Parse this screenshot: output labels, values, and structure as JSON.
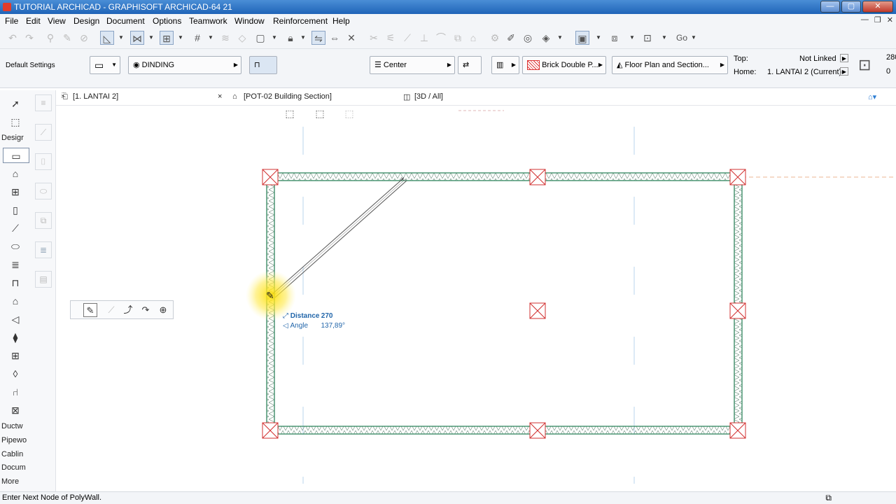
{
  "window": {
    "title": "TUTORIAL ARCHICAD - GRAPHISOFT ARCHICAD-64 21",
    "min": "—",
    "max": "▢",
    "close": "✕"
  },
  "menu": [
    "File",
    "Edit",
    "View",
    "Design",
    "Document",
    "Options",
    "Teamwork",
    "Window",
    "Reinforcement",
    "Help"
  ],
  "toolbar": {
    "go_label": "Go"
  },
  "infobox": {
    "default_settings": "Default Settings",
    "layer": "DINDING",
    "reference_line": "Center",
    "material": "Brick Double P...",
    "view_scope": "Floor Plan and Section...",
    "top_label": "Top:",
    "top_value": "Not Linked",
    "home_label": "Home:",
    "home_value": "1. LANTAI 2 (Current)",
    "height_value": "280",
    "offset_value": "0"
  },
  "tabs": [
    {
      "label": "[1. LANTAI 2]",
      "close": "×"
    },
    {
      "label": "[POT-02 Building Section]"
    },
    {
      "label": "[3D / All]"
    }
  ],
  "toolbox": {
    "design_label": "Desigr",
    "ductwork_label": "Ductw",
    "pipework_label": "Pipewo",
    "cabling_label": "Cablin",
    "document_label": "Docum",
    "more_label": "More"
  },
  "tracker": {
    "distance_label": "Distance",
    "distance_value": "270",
    "angle_label": "Angle",
    "angle_value": "137,89°"
  },
  "status": {
    "message": "Enter Next Node of PolyWall."
  }
}
